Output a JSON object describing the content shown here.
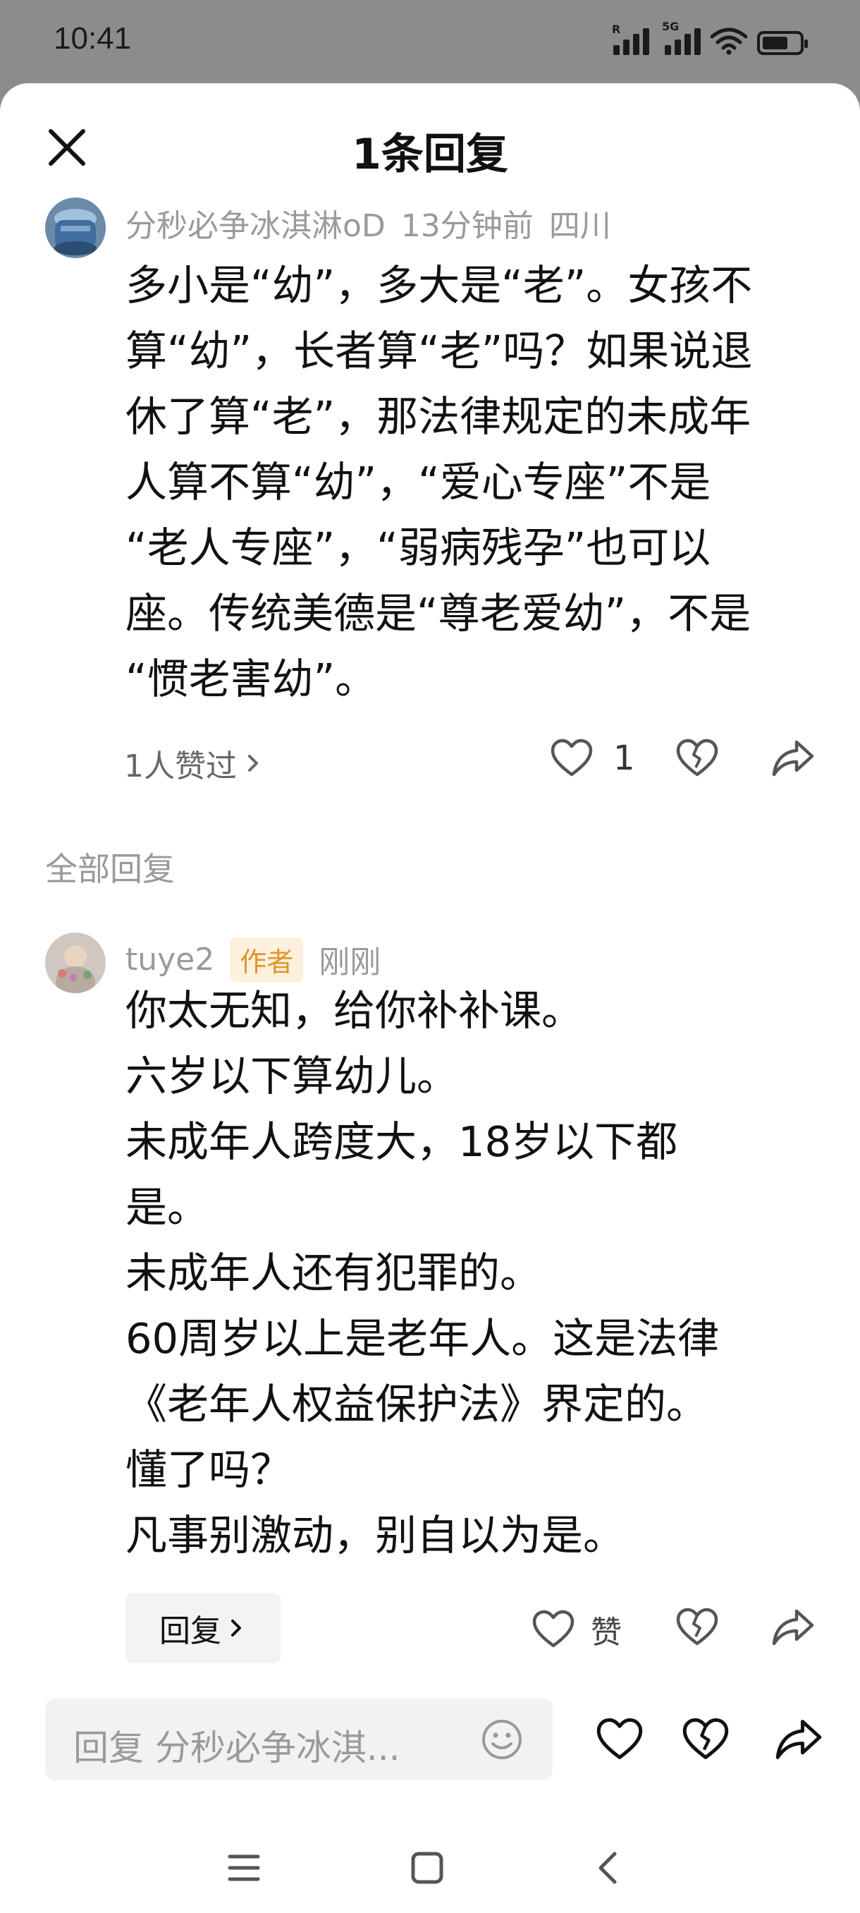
{
  "status_bar": {
    "time": "10:41",
    "signal1_tag": "R",
    "signal2_tag": "5G",
    "icons": [
      "signal-icon",
      "signal-5g-icon",
      "wifi-icon",
      "battery-icon"
    ]
  },
  "header": {
    "title": "1条回复",
    "close_icon": "close-icon"
  },
  "main_comment": {
    "username": "分秒必争冰淇淋oD",
    "time": "13分钟前",
    "location": "四川",
    "lines": [
      "多小是“幼”，多大是“老”。女孩不",
      "算“幼”，长者算“老”吗？如果说退",
      "休了算“老”，那法律规定的未成年",
      "人算不算“幼”，“爱心专座”不是",
      "“老人专座”，“弱病残孕”也可以",
      "座。传统美德是“尊老爱幼”，不是",
      "“惯老害幼”。"
    ],
    "likes_summary": "1人赞过",
    "like_count": "1"
  },
  "section": {
    "title": "全部回复"
  },
  "reply": {
    "username": "tuye2",
    "badge": "作者",
    "time": "刚刚",
    "lines": [
      "你太无知，给你补补课。",
      "六岁以下算幼儿。",
      "未成年人跨度大，18岁以下都",
      "是。",
      "未成年人还有犯罪的。",
      "60周岁以上是老年人。这是法律",
      "《老年人权益保护法》界定的。",
      "懂了吗？",
      "凡事别激动，别自以为是。"
    ],
    "reply_button": "回复",
    "like_label": "赞"
  },
  "input": {
    "placeholder": "回复 分秒必争冰淇..."
  },
  "colors": {
    "status_bg": "#8c8c8c",
    "badge_bg": "#fdf0dc",
    "badge_text": "#e0962a",
    "muted_text": "#9a9a9a"
  }
}
